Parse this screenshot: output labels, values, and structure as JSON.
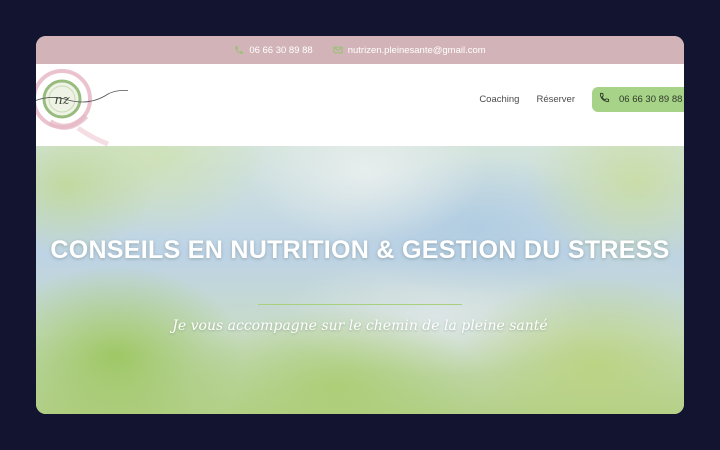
{
  "topbar": {
    "phone": "06 66 30 89 88",
    "email": "nutrizen.pleinesante@gmail.com"
  },
  "header": {
    "logo_monogram": "nz",
    "nav": [
      {
        "label": "Coaching"
      },
      {
        "label": "Réserver"
      }
    ],
    "cta_phone": "06 66 30 89 88"
  },
  "hero": {
    "title": "CONSEILS EN NUTRITION & GESTION DU STRESS",
    "subtitle": "Je vous accompagne sur le chemin de la pleine santé"
  },
  "colors": {
    "page_background": "#131530",
    "topbar": "#d2b4b8",
    "accent_green": "#a7d389",
    "logo_pink": "#e6b9c6",
    "logo_green": "#98bc7e"
  },
  "icons": {
    "topbar_phone": "phone-icon",
    "topbar_email": "mail-icon",
    "cta_phone": "phone-icon"
  }
}
